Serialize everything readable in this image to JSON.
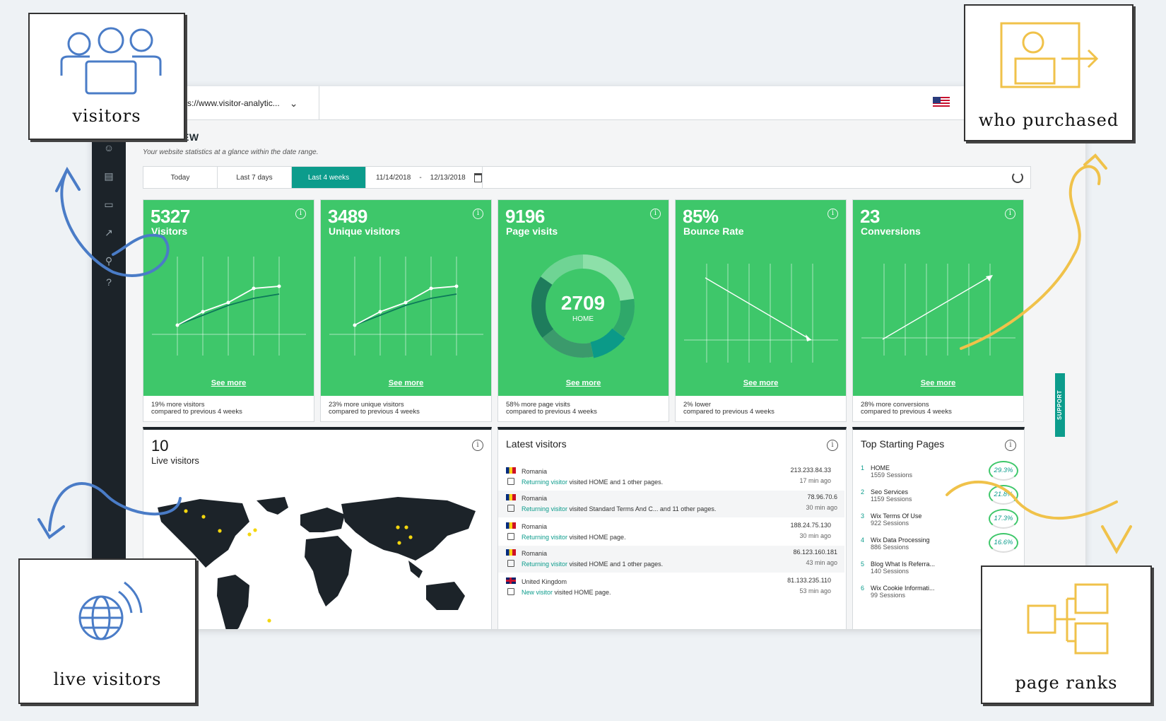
{
  "app": {
    "url": "s://www.visitor-analytic...",
    "title_partial": "EW",
    "subtitle": "Your website statistics at a glance within the date range."
  },
  "date_range": {
    "options": [
      "Today",
      "Last 7 days",
      "Last 4 weeks"
    ],
    "active": "Last 4 weeks",
    "from": "11/14/2018",
    "separator": "-",
    "to": "12/13/2018"
  },
  "cards": [
    {
      "value": "5327",
      "label": "Visitors",
      "see_more": "See more",
      "foot1": "19% more visitors",
      "foot2": "compared to previous 4 weeks"
    },
    {
      "value": "3489",
      "label": "Unique visitors",
      "see_more": "See more",
      "foot1": "23% more unique visitors",
      "foot2": "compared to previous 4 weeks"
    },
    {
      "value": "9196",
      "label": "Page visits",
      "see_more": "See more",
      "donut_value": "2709",
      "donut_label": "HOME",
      "foot1": "58% more page visits",
      "foot2": "compared to previous 4 weeks"
    },
    {
      "value": "85%",
      "label": "Bounce Rate",
      "see_more": "See more",
      "foot1": "2% lower",
      "foot2": "compared to previous 4 weeks"
    },
    {
      "value": "23",
      "label": "Conversions",
      "see_more": "See more",
      "foot1": "28% more conversions",
      "foot2": "compared to previous 4 weeks"
    }
  ],
  "live": {
    "count": "10",
    "label": "Live visitors"
  },
  "latest": {
    "title": "Latest visitors",
    "rows": [
      {
        "country": "Romania",
        "visitor_type": "Returning visitor",
        "desc": " visited HOME and 1 other pages.",
        "ip": "213.233.84.33",
        "time": "17 min ago"
      },
      {
        "country": "Romania",
        "visitor_type": "Returning visitor",
        "desc": " visited Standard Terms And C... and 11 other pages.",
        "ip": "78.96.70.6",
        "time": "30 min ago"
      },
      {
        "country": "Romania",
        "visitor_type": "Returning visitor",
        "desc": " visited HOME page.",
        "ip": "188.24.75.130",
        "time": "30 min ago"
      },
      {
        "country": "Romania",
        "visitor_type": "Returning visitor",
        "desc": " visited HOME and 1 other pages.",
        "ip": "86.123.160.181",
        "time": "43 min ago"
      },
      {
        "country": "United Kingdom",
        "visitor_type": "New visitor",
        "desc": " visited HOME page.",
        "ip": "81.133.235.110",
        "time": "53 min ago"
      }
    ]
  },
  "top_pages": {
    "title": "Top Starting Pages",
    "rows": [
      {
        "idx": "1",
        "name": "HOME",
        "sessions": "1559 Sessions",
        "pct": "29.3%"
      },
      {
        "idx": "2",
        "name": "Seo Services",
        "sessions": "1159 Sessions",
        "pct": "21.8%"
      },
      {
        "idx": "3",
        "name": "Wix Terms Of Use",
        "sessions": "922 Sessions",
        "pct": "17.3%"
      },
      {
        "idx": "4",
        "name": "Wix Data Processing",
        "sessions": "886 Sessions",
        "pct": "16.6%"
      },
      {
        "idx": "5",
        "name": "Blog What Is Referra...",
        "sessions": "140 Sessions",
        "pct": ""
      },
      {
        "idx": "6",
        "name": "Wix Cookie Informati...",
        "sessions": "99 Sessions",
        "pct": ""
      }
    ]
  },
  "support": "SUPPORT",
  "callouts": {
    "visitors": "visitors",
    "who_purchased": "who purchased",
    "live_visitors": "live visitors",
    "page_ranks": "page ranks"
  },
  "colors": {
    "card_green": "#3ec76a",
    "accent_teal": "#0c9c8c",
    "sidebar_dark": "#1c2329",
    "annotation_blue": "#4a7cc7",
    "annotation_yellow": "#f0c24a"
  }
}
